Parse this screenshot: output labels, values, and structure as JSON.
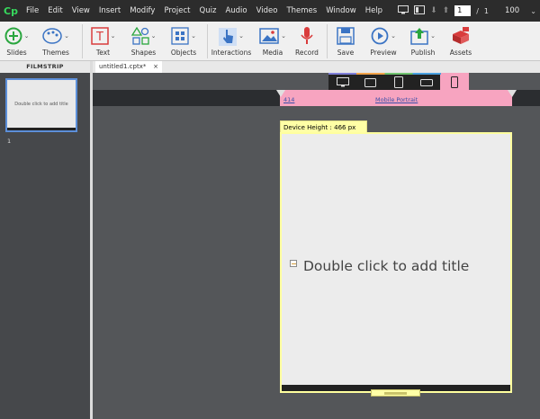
{
  "app": {
    "logo": "Cp"
  },
  "menu": [
    "File",
    "Edit",
    "View",
    "Insert",
    "Modify",
    "Project",
    "Quiz",
    "Audio",
    "Video",
    "Themes",
    "Window",
    "Help"
  ],
  "nav": {
    "current_page": "1",
    "separator": "/",
    "total_pages": "1",
    "zoom": "100"
  },
  "toolbar": {
    "slides": "Slides",
    "themes": "Themes",
    "text": "Text",
    "shapes": "Shapes",
    "objects": "Objects",
    "interactions": "Interactions",
    "media": "Media",
    "record": "Record",
    "save": "Save",
    "preview": "Preview",
    "publish": "Publish",
    "assets": "Assets"
  },
  "filmstrip": {
    "header": "FILMSTRIP",
    "slides": [
      {
        "number": "1",
        "title": "Double click to add title"
      }
    ]
  },
  "tabs": [
    {
      "label": "untitled1.cptx*",
      "close": "×"
    }
  ],
  "stage": {
    "width_label": "414",
    "device_label": "Mobile Portrait",
    "device_height_label": "Device Height : 466 px",
    "slide_title": "Double click to add title"
  },
  "icons": {
    "colors": {
      "green": "#2aa63f",
      "blue": "#3b74c4",
      "red": "#d93c3c",
      "pink": "#f7a4c0",
      "yellow": "#ffffa6"
    }
  }
}
